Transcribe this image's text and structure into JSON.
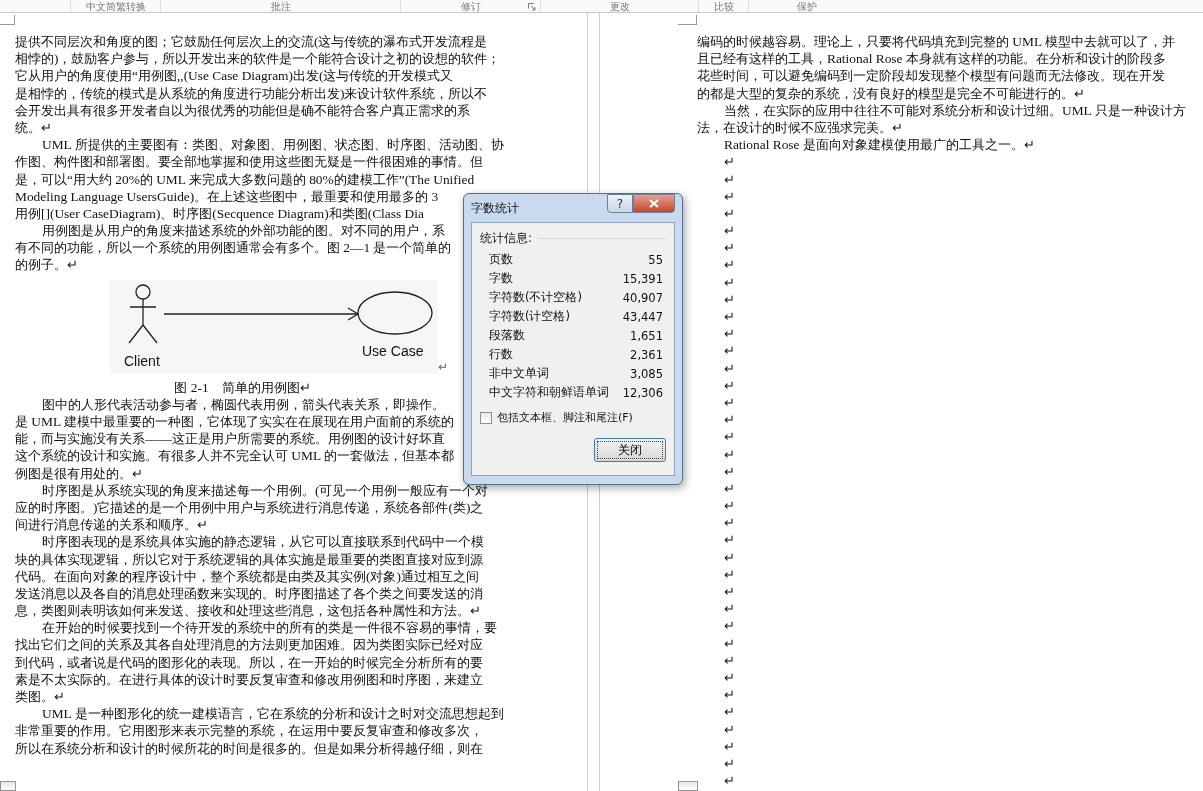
{
  "ribbon": {
    "groups": [
      {
        "label": "中文简繁转换",
        "has_launcher": false
      },
      {
        "label": "批注",
        "has_launcher": false
      },
      {
        "label": "修订",
        "has_launcher": true
      },
      {
        "label": "更改",
        "has_launcher": false
      },
      {
        "label": "比较",
        "has_launcher": false
      },
      {
        "label": "保护",
        "has_launcher": false
      }
    ]
  },
  "pages": [
    {
      "blocks": [
        {
          "kind": "paragraph",
          "continued": true,
          "lines": [
            "提供不同层次和角度的图；它鼓励任何层次上的交流(这与传统的瀑布式开发流程是",
            "相悖的)，鼓励客户参与，所以开发出来的软件是一个能符合设计之初的设想的软件；",
            "它从用户的角度使用“用例图,,(Use Case Diagram)出发(这与传统的开发模式又",
            "是相悖的，传统的模式是从系统的角度进行功能分析出发)来设计软件系统，所以不",
            "会开发出具有很多开发者自以为很优秀的功能但是确不能符合客户真正需求的系",
            "统。↵"
          ]
        },
        {
          "kind": "paragraph",
          "continued": false,
          "lines": [
            "UML 所提供的主要图有：类图、对象图、用例图、状态图、时序图、活动图、协",
            "作图、构件图和部署图。要全部地掌握和使用这些图无疑是一件很困难的事情。但",
            "是，可以“用大约 20%的 UML 来完成大多数问题的 80%的建模工作”(The Unified",
            "Modeling Language UsersGuide)。在上述这些图中，最重要和使用最多的 3",
            "用例[](User CaseDiagram)、时序图(Secquence Diagram)和类图(Class Dia"
          ]
        },
        {
          "kind": "paragraph",
          "continued": false,
          "lines": [
            "用例图是从用户的角度来描述系统的外部功能的图。对不同的用户，系",
            "有不同的功能，所以一个系统的用例图通常会有多个。图 2—1 是一个简单的",
            "的例子。↵"
          ]
        },
        {
          "kind": "figure",
          "actor_label": "Client",
          "usecase_label": "Use Case",
          "mark": "↵"
        },
        {
          "kind": "caption",
          "text": "图 2-1　简单的用例图↵"
        },
        {
          "kind": "paragraph",
          "continued": false,
          "lines": [
            "图中的人形代表活动参与者，椭圆代表用例，箭头代表关系，即操作。",
            "是 UML 建模中最重要的一种图，它体现了实实在在展现在用户面前的系统的",
            "能，而与实施没有关系——这正是用户所需要的系统。用例图的设计好坏直",
            "这个系统的设计和实施。有很多人并不完全认可 UML 的一套做法，但基本都",
            "例图是很有用处的。↵"
          ]
        },
        {
          "kind": "paragraph",
          "continued": false,
          "lines": [
            "时序图是从系统实现的角度来描述每一个用例。(可见一个用例一般应有一个对",
            "应的时序图。)它描述的是一个用例中用户与系统进行消息传递，系统各部件(类)之",
            "间进行消息传递的关系和顺序。↵"
          ]
        },
        {
          "kind": "paragraph",
          "continued": false,
          "lines": [
            "时序图表现的是系统具体实施的静态逻辑，从它可以直接联系到代码中一个模",
            "块的具体实现逻辑，所以它对于系统逻辑的具体实施是最重要的类图直接对应到源",
            "代码。在面向对象的程序设计中，整个系统都是由类及其实例(对象)通过相互之间",
            "发送消息以及各自的消息处理函数来实现的。时序图描述了各个类之间要发送的消",
            "息，类图则表明该如何来发送、接收和处理这些消息，这包括各种属性和方法。↵"
          ]
        },
        {
          "kind": "paragraph",
          "continued": false,
          "lines": [
            "在开始的时候要找到一个待开发的系统中的所有的类是一件很不容易的事情，要",
            "找出它们之间的关系及其各自处理消息的方法则更加困难。因为类图实际已经对应",
            "到代码，或者说是代码的图形化的表现。所以，在一开始的时候完全分析所有的要",
            "素是不太实际的。在进行具体的设计时要反复审查和修改用例图和时序图，来建立",
            "类图。↵"
          ]
        },
        {
          "kind": "paragraph",
          "continued": false,
          "lines": [
            "UML 是一种图形化的统一建模语言，它在系统的分析和设计之时对交流思想起到",
            "非常重要的作用。它用图形来表示完整的系统，在运用中要反复审查和修改多次，",
            "所以在系统分析和设计的时候所花的时间是很多的。但是如果分析得越仔细，则在"
          ]
        }
      ]
    },
    {
      "blocks": [
        {
          "kind": "paragraph",
          "continued": true,
          "lines": [
            "编码的时候越容易。理论上，只要将代码填充到完整的 UML 模型中去就可以了，并",
            "且已经有这样的工具，Rational Rose 本身就有这样的功能。在分析和设计的阶段多",
            "花些时间，可以避免编码到一定阶段却发现整个模型有问题而无法修改。现在开发",
            "的都是大型的复杂的系统，没有良好的模型是完全不可能进行的。↵"
          ]
        },
        {
          "kind": "paragraph",
          "continued": false,
          "lines": [
            "当然，在实际的应用中往往不可能对系统分析和设计过细。UML 只是一种设计方",
            "法，在设计的时候不应强求完美。↵"
          ]
        },
        {
          "kind": "paragraph",
          "continued": false,
          "lines": [
            "Rational Rose 是面向对象建模使用最广的工具之一。↵"
          ]
        },
        {
          "kind": "paragraph",
          "continued": false,
          "lines": [
            "↵"
          ]
        },
        {
          "kind": "paragraph",
          "continued": false,
          "lines": [
            "↵"
          ]
        },
        {
          "kind": "paragraph",
          "continued": false,
          "lines": [
            "↵"
          ]
        },
        {
          "kind": "paragraph",
          "continued": false,
          "lines": [
            "↵"
          ]
        },
        {
          "kind": "paragraph",
          "continued": false,
          "lines": [
            "↵"
          ]
        },
        {
          "kind": "paragraph",
          "continued": false,
          "lines": [
            "↵"
          ]
        },
        {
          "kind": "paragraph",
          "continued": false,
          "lines": [
            "↵"
          ]
        },
        {
          "kind": "paragraph",
          "continued": false,
          "lines": [
            "↵"
          ]
        },
        {
          "kind": "paragraph",
          "continued": false,
          "lines": [
            "↵"
          ]
        },
        {
          "kind": "paragraph",
          "continued": false,
          "lines": [
            "↵"
          ]
        },
        {
          "kind": "paragraph",
          "continued": false,
          "lines": [
            "↵"
          ]
        },
        {
          "kind": "paragraph",
          "continued": false,
          "lines": [
            "↵"
          ]
        },
        {
          "kind": "paragraph",
          "continued": false,
          "lines": [
            "↵"
          ]
        },
        {
          "kind": "paragraph",
          "continued": false,
          "lines": [
            "↵"
          ]
        },
        {
          "kind": "paragraph",
          "continued": false,
          "lines": [
            "↵"
          ]
        },
        {
          "kind": "paragraph",
          "continued": false,
          "lines": [
            "↵"
          ]
        },
        {
          "kind": "paragraph",
          "continued": false,
          "lines": [
            "↵"
          ]
        },
        {
          "kind": "paragraph",
          "continued": false,
          "lines": [
            "↵"
          ]
        },
        {
          "kind": "paragraph",
          "continued": false,
          "lines": [
            "↵"
          ]
        },
        {
          "kind": "paragraph",
          "continued": false,
          "lines": [
            "↵"
          ]
        },
        {
          "kind": "paragraph",
          "continued": false,
          "lines": [
            "↵"
          ]
        },
        {
          "kind": "paragraph",
          "continued": false,
          "lines": [
            "↵"
          ]
        },
        {
          "kind": "paragraph",
          "continued": false,
          "lines": [
            "↵"
          ]
        },
        {
          "kind": "paragraph",
          "continued": false,
          "lines": [
            "↵"
          ]
        },
        {
          "kind": "paragraph",
          "continued": false,
          "lines": [
            "↵"
          ]
        },
        {
          "kind": "paragraph",
          "continued": false,
          "lines": [
            "↵"
          ]
        },
        {
          "kind": "paragraph",
          "continued": false,
          "lines": [
            "↵"
          ]
        },
        {
          "kind": "paragraph",
          "continued": false,
          "lines": [
            "↵"
          ]
        },
        {
          "kind": "paragraph",
          "continued": false,
          "lines": [
            "↵"
          ]
        },
        {
          "kind": "paragraph",
          "continued": false,
          "lines": [
            "↵"
          ]
        },
        {
          "kind": "paragraph",
          "continued": false,
          "lines": [
            "↵"
          ]
        },
        {
          "kind": "paragraph",
          "continued": false,
          "lines": [
            "↵"
          ]
        },
        {
          "kind": "paragraph",
          "continued": false,
          "lines": [
            "↵"
          ]
        },
        {
          "kind": "paragraph",
          "continued": false,
          "lines": [
            "↵"
          ]
        },
        {
          "kind": "paragraph",
          "continued": false,
          "lines": [
            "↵"
          ]
        },
        {
          "kind": "paragraph",
          "continued": false,
          "lines": [
            "↵"
          ]
        },
        {
          "kind": "paragraph",
          "continued": false,
          "lines": [
            "↵"
          ]
        }
      ]
    }
  ],
  "dialog": {
    "title": "字数统计",
    "help_button": "?",
    "section_label": "统计信息:",
    "rows": [
      {
        "label": "页数",
        "value": "55"
      },
      {
        "label": "字数",
        "value": "15,391"
      },
      {
        "label": "字符数(不计空格)",
        "value": "40,907"
      },
      {
        "label": "字符数(计空格)",
        "value": "43,447"
      },
      {
        "label": "段落数",
        "value": "1,651"
      },
      {
        "label": "行数",
        "value": "2,361"
      },
      {
        "label": "非中文单词",
        "value": "3,085"
      },
      {
        "label": "中文字符和朝鲜语单词",
        "value": "12,306"
      }
    ],
    "option": {
      "label": "包括文本框、脚注和尾注(F)",
      "checked": false
    },
    "close_button": "关闭"
  }
}
